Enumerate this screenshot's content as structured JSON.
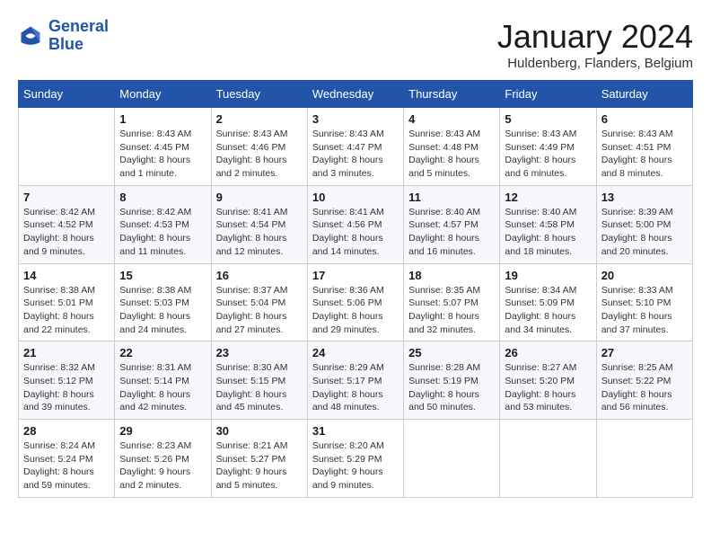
{
  "logo": {
    "line1": "General",
    "line2": "Blue"
  },
  "title": "January 2024",
  "location": "Huldenberg, Flanders, Belgium",
  "days_of_week": [
    "Sunday",
    "Monday",
    "Tuesday",
    "Wednesday",
    "Thursday",
    "Friday",
    "Saturday"
  ],
  "weeks": [
    [
      {
        "day": "",
        "info": ""
      },
      {
        "day": "1",
        "info": "Sunrise: 8:43 AM\nSunset: 4:45 PM\nDaylight: 8 hours\nand 1 minute."
      },
      {
        "day": "2",
        "info": "Sunrise: 8:43 AM\nSunset: 4:46 PM\nDaylight: 8 hours\nand 2 minutes."
      },
      {
        "day": "3",
        "info": "Sunrise: 8:43 AM\nSunset: 4:47 PM\nDaylight: 8 hours\nand 3 minutes."
      },
      {
        "day": "4",
        "info": "Sunrise: 8:43 AM\nSunset: 4:48 PM\nDaylight: 8 hours\nand 5 minutes."
      },
      {
        "day": "5",
        "info": "Sunrise: 8:43 AM\nSunset: 4:49 PM\nDaylight: 8 hours\nand 6 minutes."
      },
      {
        "day": "6",
        "info": "Sunrise: 8:43 AM\nSunset: 4:51 PM\nDaylight: 8 hours\nand 8 minutes."
      }
    ],
    [
      {
        "day": "7",
        "info": "Sunrise: 8:42 AM\nSunset: 4:52 PM\nDaylight: 8 hours\nand 9 minutes."
      },
      {
        "day": "8",
        "info": "Sunrise: 8:42 AM\nSunset: 4:53 PM\nDaylight: 8 hours\nand 11 minutes."
      },
      {
        "day": "9",
        "info": "Sunrise: 8:41 AM\nSunset: 4:54 PM\nDaylight: 8 hours\nand 12 minutes."
      },
      {
        "day": "10",
        "info": "Sunrise: 8:41 AM\nSunset: 4:56 PM\nDaylight: 8 hours\nand 14 minutes."
      },
      {
        "day": "11",
        "info": "Sunrise: 8:40 AM\nSunset: 4:57 PM\nDaylight: 8 hours\nand 16 minutes."
      },
      {
        "day": "12",
        "info": "Sunrise: 8:40 AM\nSunset: 4:58 PM\nDaylight: 8 hours\nand 18 minutes."
      },
      {
        "day": "13",
        "info": "Sunrise: 8:39 AM\nSunset: 5:00 PM\nDaylight: 8 hours\nand 20 minutes."
      }
    ],
    [
      {
        "day": "14",
        "info": "Sunrise: 8:38 AM\nSunset: 5:01 PM\nDaylight: 8 hours\nand 22 minutes."
      },
      {
        "day": "15",
        "info": "Sunrise: 8:38 AM\nSunset: 5:03 PM\nDaylight: 8 hours\nand 24 minutes."
      },
      {
        "day": "16",
        "info": "Sunrise: 8:37 AM\nSunset: 5:04 PM\nDaylight: 8 hours\nand 27 minutes."
      },
      {
        "day": "17",
        "info": "Sunrise: 8:36 AM\nSunset: 5:06 PM\nDaylight: 8 hours\nand 29 minutes."
      },
      {
        "day": "18",
        "info": "Sunrise: 8:35 AM\nSunset: 5:07 PM\nDaylight: 8 hours\nand 32 minutes."
      },
      {
        "day": "19",
        "info": "Sunrise: 8:34 AM\nSunset: 5:09 PM\nDaylight: 8 hours\nand 34 minutes."
      },
      {
        "day": "20",
        "info": "Sunrise: 8:33 AM\nSunset: 5:10 PM\nDaylight: 8 hours\nand 37 minutes."
      }
    ],
    [
      {
        "day": "21",
        "info": "Sunrise: 8:32 AM\nSunset: 5:12 PM\nDaylight: 8 hours\nand 39 minutes."
      },
      {
        "day": "22",
        "info": "Sunrise: 8:31 AM\nSunset: 5:14 PM\nDaylight: 8 hours\nand 42 minutes."
      },
      {
        "day": "23",
        "info": "Sunrise: 8:30 AM\nSunset: 5:15 PM\nDaylight: 8 hours\nand 45 minutes."
      },
      {
        "day": "24",
        "info": "Sunrise: 8:29 AM\nSunset: 5:17 PM\nDaylight: 8 hours\nand 48 minutes."
      },
      {
        "day": "25",
        "info": "Sunrise: 8:28 AM\nSunset: 5:19 PM\nDaylight: 8 hours\nand 50 minutes."
      },
      {
        "day": "26",
        "info": "Sunrise: 8:27 AM\nSunset: 5:20 PM\nDaylight: 8 hours\nand 53 minutes."
      },
      {
        "day": "27",
        "info": "Sunrise: 8:25 AM\nSunset: 5:22 PM\nDaylight: 8 hours\nand 56 minutes."
      }
    ],
    [
      {
        "day": "28",
        "info": "Sunrise: 8:24 AM\nSunset: 5:24 PM\nDaylight: 8 hours\nand 59 minutes."
      },
      {
        "day": "29",
        "info": "Sunrise: 8:23 AM\nSunset: 5:26 PM\nDaylight: 9 hours\nand 2 minutes."
      },
      {
        "day": "30",
        "info": "Sunrise: 8:21 AM\nSunset: 5:27 PM\nDaylight: 9 hours\nand 5 minutes."
      },
      {
        "day": "31",
        "info": "Sunrise: 8:20 AM\nSunset: 5:29 PM\nDaylight: 9 hours\nand 9 minutes."
      },
      {
        "day": "",
        "info": ""
      },
      {
        "day": "",
        "info": ""
      },
      {
        "day": "",
        "info": ""
      }
    ]
  ]
}
